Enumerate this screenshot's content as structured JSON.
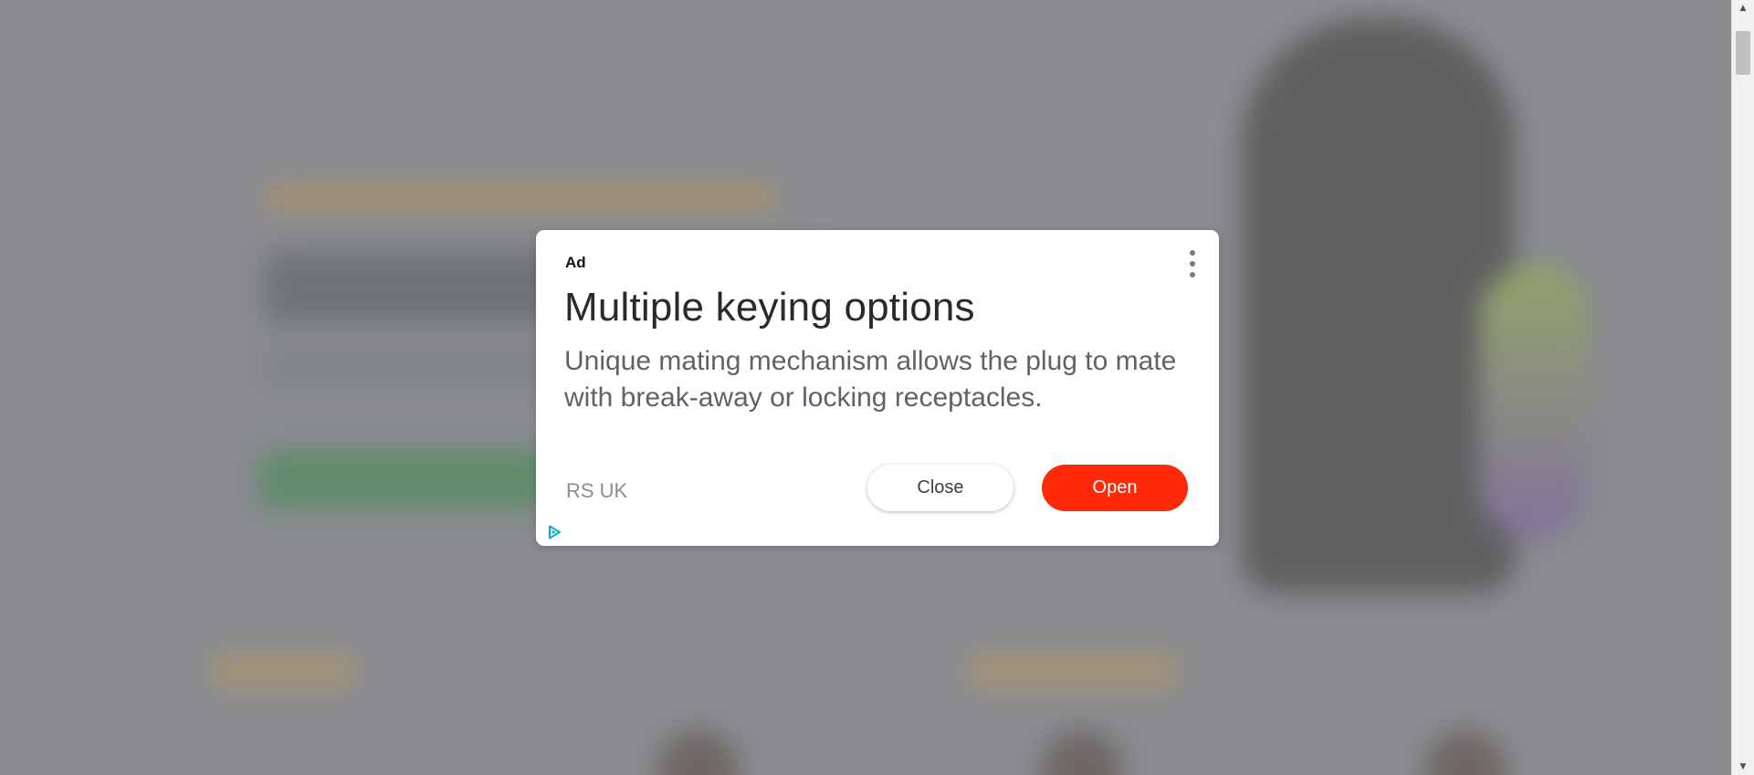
{
  "ad": {
    "label": "Ad",
    "headline": "Multiple keying options",
    "description": "Unique mating mechanism allows the plug to mate with break-away or locking receptacles.",
    "advertiser": "RS UK",
    "close_label": "Close",
    "open_label": "Open",
    "menu_icon": "more-vert-icon",
    "adchoices_icon": "adchoices-icon"
  },
  "colors": {
    "overlay": "#8a8c90",
    "open_button": "#ff2a0a",
    "adchoices": "#00aecd"
  },
  "scrollbar": {
    "up_icon": "▲",
    "down_icon": "▼"
  }
}
